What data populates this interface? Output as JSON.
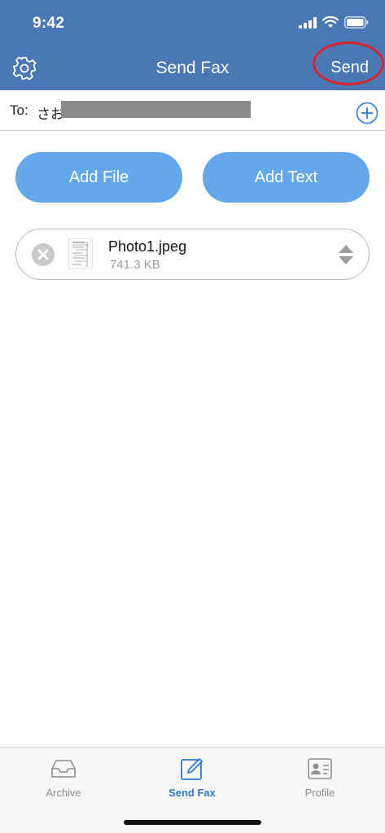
{
  "status_bar": {
    "time": "9:42",
    "icons": [
      "cellular-signal-icon",
      "wifi-icon",
      "battery-icon"
    ]
  },
  "nav": {
    "title": "Send Fax",
    "settings_icon": "gear-icon",
    "send_label": "Send"
  },
  "recipient": {
    "label": "To:",
    "value": "さお",
    "add_icon": "plus-circle-icon"
  },
  "actions": {
    "add_file": "Add File",
    "add_text": "Add Text"
  },
  "attachment": {
    "file_name": "Photo1.jpeg",
    "file_size": "741.3 KB",
    "remove_icon": "remove-circle-icon",
    "reorder_icon": "reorder-arrows-icon"
  },
  "tabs": [
    {
      "label": "Archive",
      "icon": "tray-icon",
      "active": false
    },
    {
      "label": "Send Fax",
      "icon": "pencil-square-icon",
      "active": true
    },
    {
      "label": "Profile",
      "icon": "id-card-icon",
      "active": false
    }
  ],
  "colors": {
    "header": "#4a78b5",
    "button": "#62a8ea",
    "active_tab": "#2f7ad6",
    "annotation_circle": "#d9232d"
  }
}
